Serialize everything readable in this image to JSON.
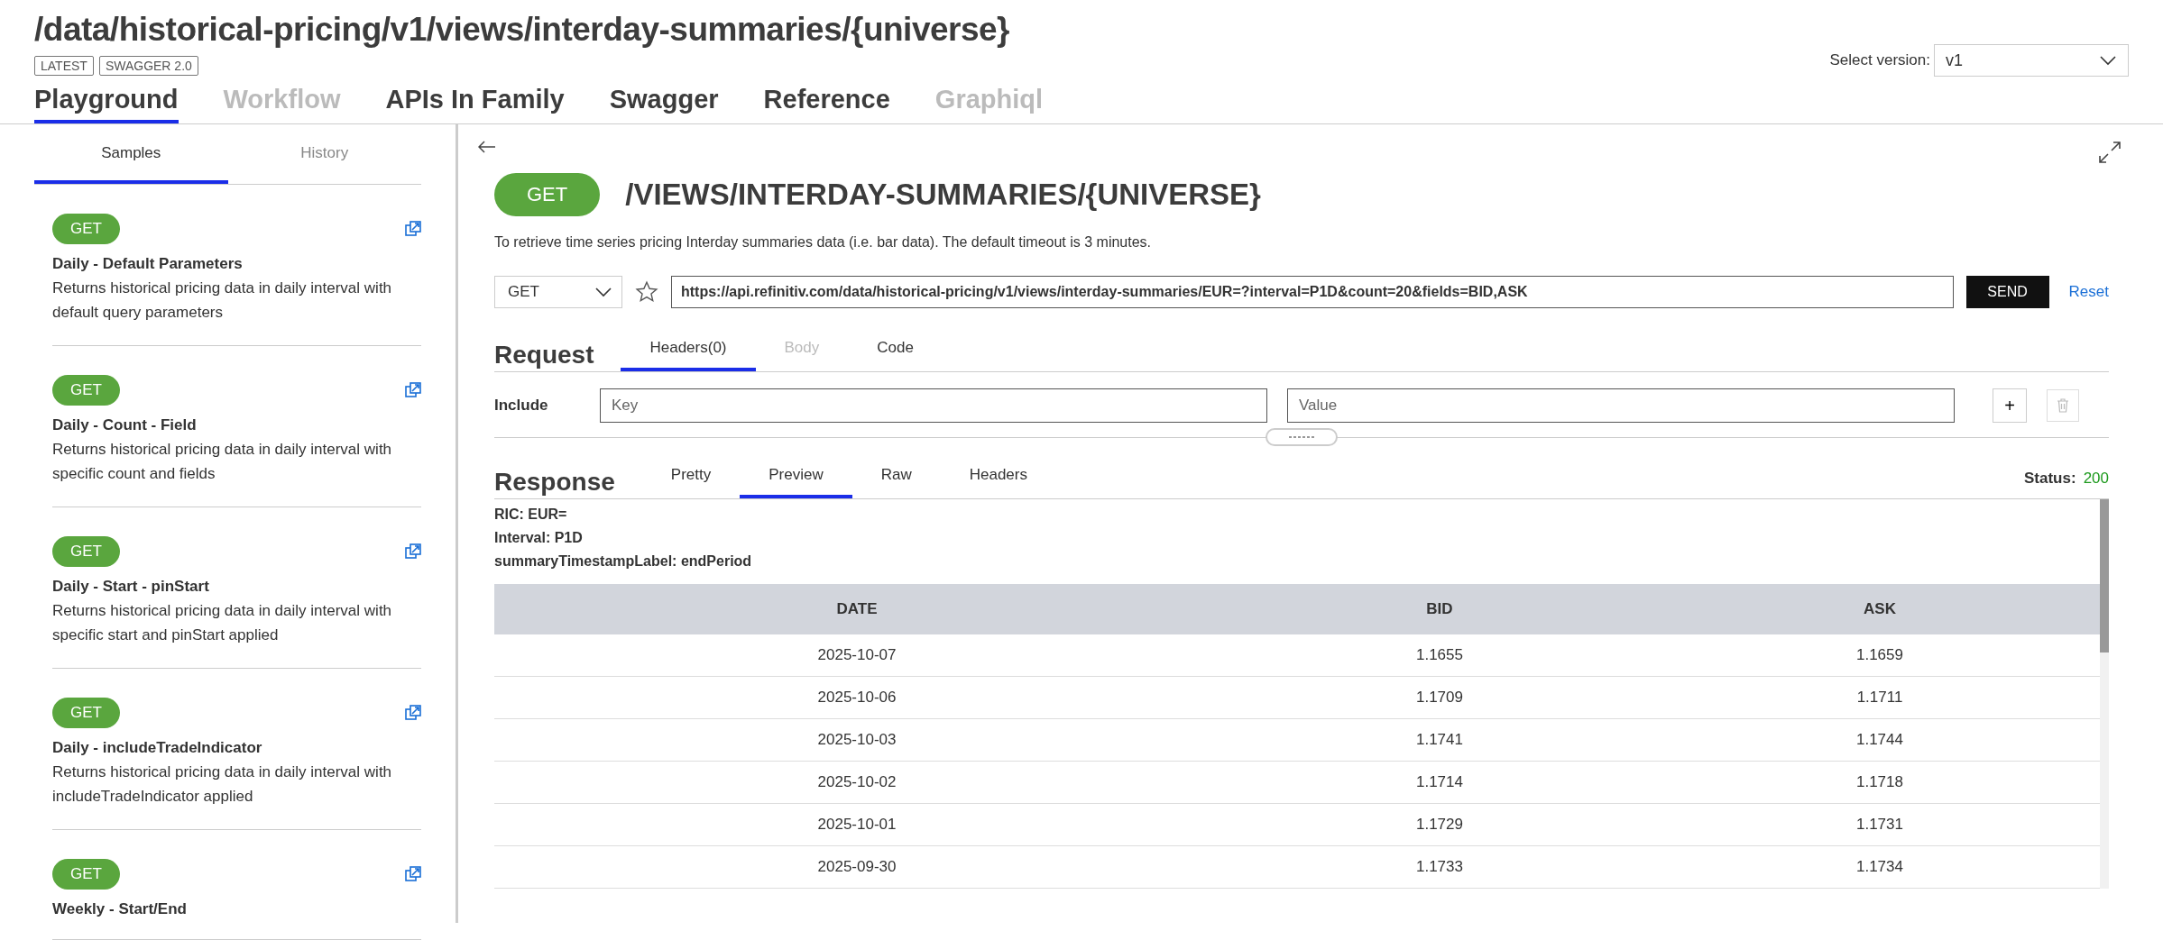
{
  "page": {
    "title": "/data/historical-pricing/v1/views/interday-summaries/{universe}",
    "badges": [
      "LATEST",
      "SWAGGER 2.0"
    ],
    "version_label": "Select version:",
    "version_value": "v1"
  },
  "nav_tabs": [
    {
      "label": "Playground",
      "selected": true,
      "disabled": false
    },
    {
      "label": "Workflow",
      "selected": false,
      "disabled": true
    },
    {
      "label": "APIs In Family",
      "selected": false,
      "disabled": false
    },
    {
      "label": "Swagger",
      "selected": false,
      "disabled": false
    },
    {
      "label": "Reference",
      "selected": false,
      "disabled": false
    },
    {
      "label": "Graphiql",
      "selected": false,
      "disabled": true
    }
  ],
  "sidebar": {
    "tabs": [
      {
        "label": "Samples",
        "selected": true
      },
      {
        "label": "History",
        "selected": false
      }
    ],
    "items": [
      {
        "method": "GET",
        "title": "Daily - Default Parameters",
        "description": "Returns historical pricing data in daily interval with default query parameters"
      },
      {
        "method": "GET",
        "title": "Daily - Count - Field",
        "description": "Returns historical pricing data in daily interval with specific count and fields"
      },
      {
        "method": "GET",
        "title": "Daily - Start - pinStart",
        "description": "Returns historical pricing data in daily interval with specific start and pinStart applied"
      },
      {
        "method": "GET",
        "title": "Daily - includeTradeIndicator",
        "description": "Returns historical pricing data in daily interval with includeTradeIndicator applied"
      },
      {
        "method": "GET",
        "title": "Weekly - Start/End"
      }
    ]
  },
  "endpoint": {
    "method": "GET",
    "path": "/VIEWS/INTERDAY-SUMMARIES/{UNIVERSE}",
    "description": "To retrieve time series pricing Interday summaries data (i.e. bar data). The default timeout is 3 minutes.",
    "request_method": "GET",
    "url": "https://api.refinitiv.com/data/historical-pricing/v1/views/interday-summaries/EUR=?interval=P1D&count=20&fields=BID,ASK",
    "send": "SEND",
    "reset": "Reset"
  },
  "request": {
    "title": "Request",
    "tabs": [
      {
        "label": "Headers(0)",
        "selected": true,
        "disabled": false
      },
      {
        "label": "Body",
        "selected": false,
        "disabled": true
      },
      {
        "label": "Code",
        "selected": false,
        "disabled": false
      }
    ],
    "include_label": "Include",
    "key_placeholder": "Key",
    "value_placeholder": "Value",
    "add": "+"
  },
  "response": {
    "title": "Response",
    "tabs": [
      {
        "label": "Pretty",
        "selected": false
      },
      {
        "label": "Preview",
        "selected": true
      },
      {
        "label": "Raw",
        "selected": false
      },
      {
        "label": "Headers",
        "selected": false
      }
    ],
    "status_label": "Status:",
    "status_value": "200",
    "meta": [
      "RIC: EUR=",
      "Interval: P1D",
      "summaryTimestampLabel: endPeriod"
    ],
    "columns": [
      "DATE",
      "BID",
      "ASK"
    ],
    "rows": [
      [
        "2025-10-07",
        "1.1655",
        "1.1659"
      ],
      [
        "2025-10-06",
        "1.1709",
        "1.1711"
      ],
      [
        "2025-10-03",
        "1.1741",
        "1.1744"
      ],
      [
        "2025-10-02",
        "1.1714",
        "1.1718"
      ],
      [
        "2025-10-01",
        "1.1729",
        "1.1731"
      ],
      [
        "2025-09-30",
        "1.1733",
        "1.1734"
      ]
    ]
  }
}
